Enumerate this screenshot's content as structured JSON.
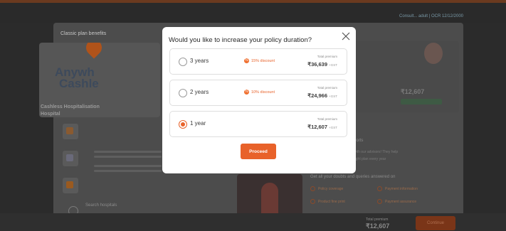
{
  "background": {
    "topbar_text": "Consult... adult | OCR 12/12/2000",
    "page_title": "Classic plan benefits",
    "banner_text_1": "Anywh",
    "banner_text_2": "Cashle",
    "cashless_title": "Cashless Hospitalisation Hospital",
    "right_price": "₹12,607",
    "support_heading": "ports",
    "support_line": "with our advisors! They help",
    "support_line_2": "right plan every year",
    "queries_heading": "Get all your doubts and queries answered on",
    "chips": [
      "Policy coverage",
      "Payment information",
      "Product fine print",
      "Payment assurance"
    ],
    "search_label": "Search hospitals",
    "bottom_label": "Total premium",
    "bottom_price": "₹12,607",
    "bottom_button": "Continue"
  },
  "modal": {
    "title": "Would you like to increase your policy duration?",
    "options": [
      {
        "label": "3 years",
        "discount": "15% discount",
        "total_label": "Total premium",
        "amount": "₹36,639",
        "gst": "+GST",
        "selected": false
      },
      {
        "label": "2 years",
        "discount": "10% discount",
        "total_label": "Total premium",
        "amount": "₹24,966",
        "gst": "+GST",
        "selected": false
      },
      {
        "label": "1 year",
        "discount": "",
        "total_label": "Total premium",
        "amount": "₹12,607",
        "gst": "+GST",
        "selected": true
      }
    ],
    "proceed_label": "Proceed"
  },
  "colors": {
    "accent": "#e8622a",
    "overlay": "#2b2b2b"
  }
}
